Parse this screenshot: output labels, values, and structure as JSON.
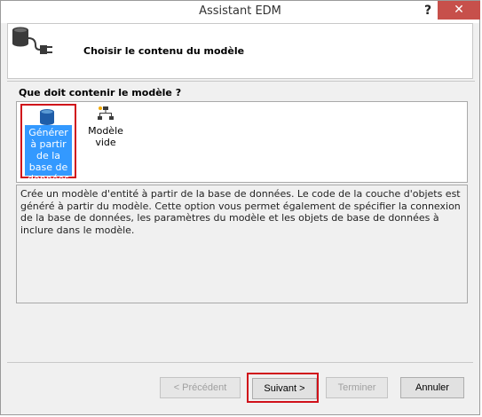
{
  "window": {
    "title": "Assistant EDM",
    "help_label": "?",
    "close_label": "✕"
  },
  "header": {
    "title": "Choisir le contenu du modèle",
    "icon": "database-connection-icon"
  },
  "content": {
    "question": "Que doit contenir le modèle ?",
    "options": [
      {
        "label": "Générer à partir de la base de données",
        "icon": "database-icon",
        "selected": true
      },
      {
        "label": "Modèle vide",
        "icon": "empty-model-icon",
        "selected": false
      }
    ],
    "description": "Crée un modèle d'entité à partir de la base de données. Le code de la couche d'objets est généré à partir du modèle. Cette option vous permet également de spécifier la connexion de la base de données, les paramètres du modèle et les objets de base de données à inclure dans le modèle."
  },
  "buttons": {
    "previous": "< Précédent",
    "next": "Suivant >",
    "finish": "Terminer",
    "cancel": "Annuler"
  },
  "colors": {
    "selection": "#3399ff",
    "highlight_frame": "#d0111a",
    "close_button": "#c7504b"
  }
}
